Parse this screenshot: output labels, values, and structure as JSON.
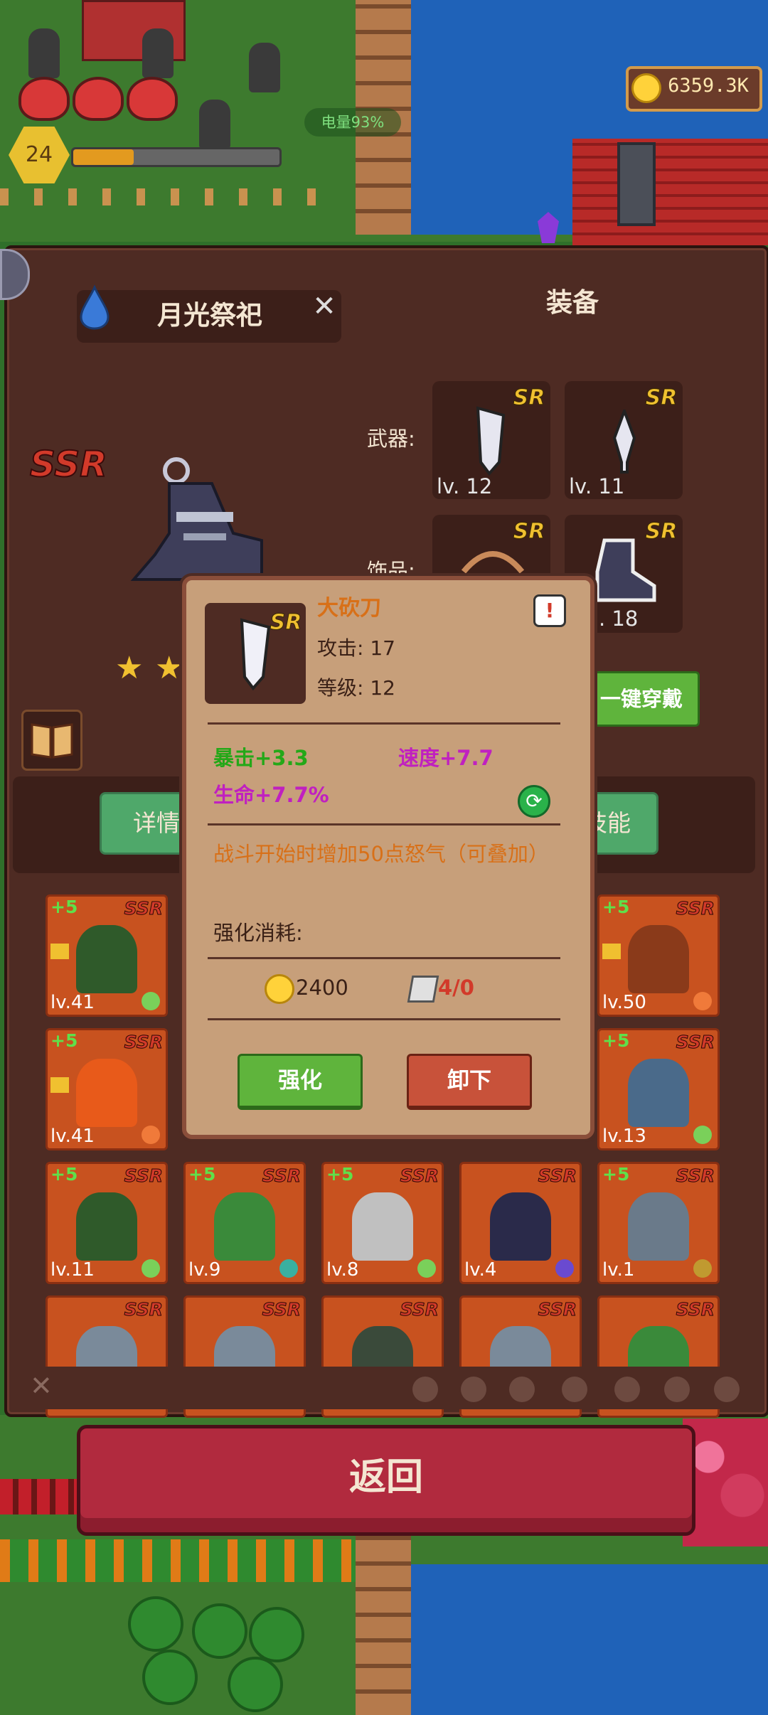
{
  "hud": {
    "gold": "6359.3K",
    "player_level": "24",
    "xp_progress": 0.3,
    "battery": "电量93%",
    "hearts": 3
  },
  "hero": {
    "name": "月光祭祀",
    "rarity": "SSR",
    "stars": 2
  },
  "equipment": {
    "title": "装备",
    "weapon_label": "武器:",
    "accessory_label": "饰品:",
    "slots": [
      {
        "rarity": "SR",
        "level": "lv. 12"
      },
      {
        "rarity": "SR",
        "level": "lv. 11"
      },
      {
        "rarity": "SR",
        "level": ""
      },
      {
        "rarity": "SR",
        "level": ". 18"
      }
    ],
    "wear_all": "一键穿戴"
  },
  "tabs": {
    "detail": "详情",
    "skill": "技能"
  },
  "item_popup": {
    "name": "大砍刀",
    "rarity": "SR",
    "attack": "攻击: 17",
    "level": "等级: 12",
    "stat_crit": "暴击+3.3",
    "stat_speed": "速度+7.7",
    "stat_hp": "生命+7.7%",
    "description": "战斗开始时增加50点怒气（可叠加）",
    "cost_label": "强化消耗:",
    "coin_cost": "2400",
    "stone_cost": "4/0",
    "upgrade_button": "强化",
    "unequip_button": "卸下"
  },
  "hero_cards": [
    {
      "plus": "+5",
      "rarity": "SSR",
      "level": "lv.41",
      "color": "#2f5a2a",
      "elem": "#7ad05a"
    },
    {
      "plus": "+5",
      "rarity": "SSR",
      "level": "lv.50",
      "color": "#8a3a1a",
      "elem": "#f07a3a"
    },
    {
      "plus": "+5",
      "rarity": "SSR",
      "level": "lv.41",
      "color": "#e85a1a",
      "elem": "#f07a3a"
    },
    {
      "plus": "+5",
      "rarity": "SSR",
      "level": "lv.13",
      "color": "#4a6a8a",
      "elem": "#7ad05a"
    },
    {
      "plus": "+5",
      "rarity": "SSR",
      "level": "lv.11",
      "color": "#2f5a2a",
      "elem": "#7ad05a"
    },
    {
      "plus": "+5",
      "rarity": "SSR",
      "level": "lv.9",
      "color": "#3a8a3a",
      "elem": "#3ab0a0"
    },
    {
      "plus": "+5",
      "rarity": "SSR",
      "level": "lv.8",
      "color": "#c0c0c0",
      "elem": "#7ad05a"
    },
    {
      "plus": "",
      "rarity": "SSR",
      "level": "lv.4",
      "color": "#2a2a4a",
      "elem": "#6a4ad0"
    },
    {
      "plus": "+5",
      "rarity": "SSR",
      "level": "lv.1",
      "color": "#6a7a8a",
      "elem": "#c09a30"
    },
    {
      "plus": "",
      "rarity": "SSR",
      "level": "",
      "color": "#7a8a9a",
      "elem": ""
    },
    {
      "plus": "",
      "rarity": "SSR",
      "level": "",
      "color": "#7a8a9a",
      "elem": ""
    },
    {
      "plus": "",
      "rarity": "SSR",
      "level": "",
      "color": "#3a4a3a",
      "elem": ""
    },
    {
      "plus": "",
      "rarity": "SSR",
      "level": "",
      "color": "#7a8a9a",
      "elem": ""
    },
    {
      "plus": "",
      "rarity": "SSR",
      "level": "",
      "color": "#3a8a3a",
      "elem": ""
    }
  ],
  "filter": {
    "close": "✕"
  },
  "return_button": "返回"
}
